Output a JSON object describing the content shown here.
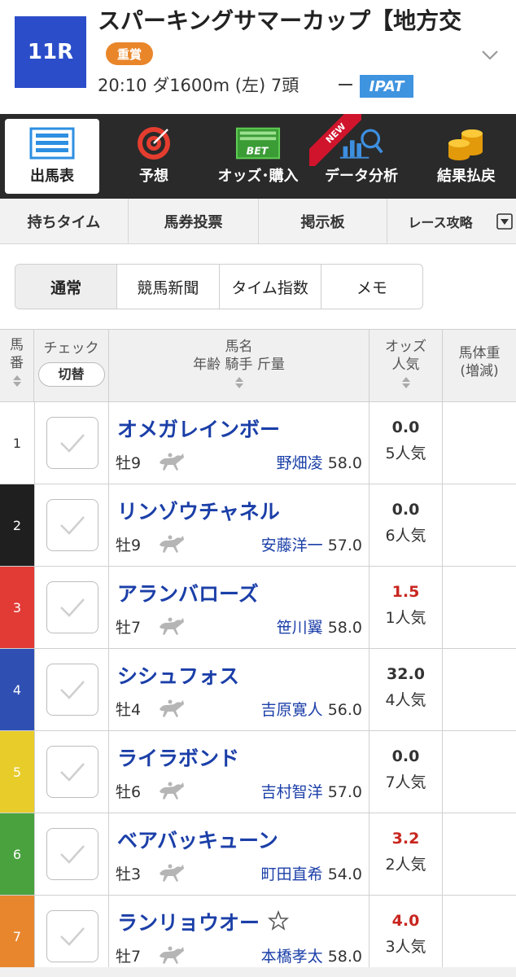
{
  "race": {
    "number": "11R",
    "title": "スパーキングサマーカップ【地方交",
    "grade": "重賞",
    "meta": "20:10 ダ1600m (左) 7頭",
    "dash": "ー",
    "ipat": "IPAT"
  },
  "main_nav": {
    "items": [
      {
        "label": "出馬表",
        "icon": "entry-list-icon"
      },
      {
        "label": "予想",
        "icon": "target-icon"
      },
      {
        "label": "オッズ･購入",
        "icon": "bet-board-icon"
      },
      {
        "label": "データ分析",
        "icon": "chart-search-icon"
      },
      {
        "label": "結果払戻",
        "icon": "coins-icon"
      }
    ],
    "new_label": "NEW"
  },
  "sub_nav": {
    "items": [
      "持ちタイム",
      "馬券投票",
      "掲示板",
      "レース攻略"
    ]
  },
  "view_tabs": [
    "通常",
    "競馬新聞",
    "タイム指数",
    "メモ"
  ],
  "table": {
    "headers": {
      "number": "馬\n番",
      "check": "チェック",
      "switch": "切替",
      "horse_line1": "馬名",
      "horse_line2": "年齢 騎手 斤量",
      "odds_line1": "オッズ",
      "odds_line2": "人気",
      "weight_line1": "馬体重",
      "weight_line2": "(増減)"
    },
    "rows": [
      {
        "num": "1",
        "name": "オメガレインボー",
        "sexage": "牡9",
        "jockey": "野畑凌",
        "weight": "58.0",
        "odds": "0.0",
        "pop": "5人気",
        "waku_color": "#ffffff",
        "num_color": "#333333",
        "hot": false
      },
      {
        "num": "2",
        "name": "リンゾウチャネル",
        "sexage": "牡9",
        "jockey": "安藤洋一",
        "weight": "57.0",
        "odds": "0.0",
        "pop": "6人気",
        "waku_color": "#1f1f1f",
        "num_color": "#ffffff",
        "hot": false
      },
      {
        "num": "3",
        "name": "アランバローズ",
        "sexage": "牡7",
        "jockey": "笹川翼",
        "weight": "58.0",
        "odds": "1.5",
        "pop": "1人気",
        "waku_color": "#e23b36",
        "num_color": "#ffffff",
        "hot": true
      },
      {
        "num": "4",
        "name": "シシュフォス",
        "sexage": "牡4",
        "jockey": "吉原寛人",
        "weight": "56.0",
        "odds": "32.0",
        "pop": "4人気",
        "waku_color": "#2f4fb3",
        "num_color": "#ffffff",
        "hot": false
      },
      {
        "num": "5",
        "name": "ライラボンド",
        "sexage": "牡6",
        "jockey": "吉村智洋",
        "weight": "57.0",
        "odds": "0.0",
        "pop": "7人気",
        "waku_color": "#e8cc2a",
        "num_color": "#ffffff",
        "hot": false
      },
      {
        "num": "6",
        "name": "ベアバッキューン",
        "sexage": "牡3",
        "jockey": "町田直希",
        "weight": "54.0",
        "odds": "3.2",
        "pop": "2人気",
        "waku_color": "#4aa23f",
        "num_color": "#ffffff",
        "hot": true
      },
      {
        "num": "7",
        "name": "ランリョウオー",
        "sexage": "牡7",
        "jockey": "本橋孝太",
        "weight": "58.0",
        "odds": "4.0",
        "pop": "3人気",
        "waku_color": "#e8862e",
        "num_color": "#ffffff",
        "hot": true,
        "starred": true
      }
    ]
  },
  "colors": {
    "race_badge": "#2b4dc9",
    "grade": "#e9862a",
    "ipat": "#3f94e0",
    "nav_bg": "#2a2a2a",
    "horse_name": "#1b3fa8",
    "hot_odds": "#c8261f"
  }
}
